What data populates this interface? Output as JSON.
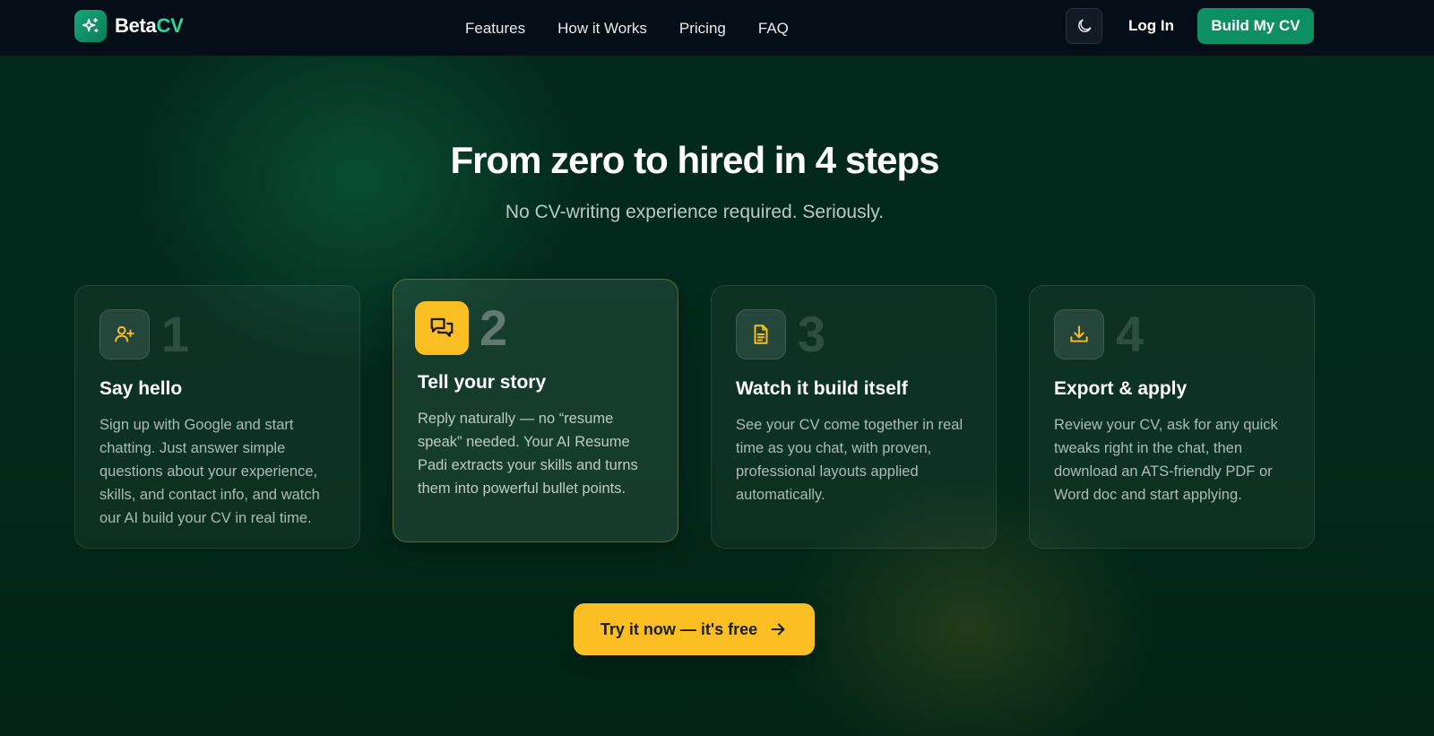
{
  "brand": {
    "name_part1": "Beta",
    "name_part2": "CV",
    "accent": "#34d399",
    "logo_icon": "sparkles-icon"
  },
  "nav": {
    "links": [
      "Features",
      "How it Works",
      "Pricing",
      "FAQ"
    ],
    "theme_toggle_icon": "moon-icon",
    "login_label": "Log In",
    "cta_label": "Build My CV",
    "cta_color": "#0e8f63"
  },
  "section": {
    "title": "From zero to hired in 4 steps",
    "subtitle": "No CV-writing experience required. Seriously."
  },
  "steps": [
    {
      "number": "1",
      "icon": "user-plus-icon",
      "title": "Say hello",
      "description": "Sign up with Google and start chatting. Just answer simple questions about your experience, skills, and contact info, and watch our AI build your CV in real time.",
      "active": false
    },
    {
      "number": "2",
      "icon": "chat-bubbles-icon",
      "title": "Tell your story",
      "description": "Reply naturally — no “resume speak” needed. Your AI Resume Padi extracts your skills and turns them into powerful bullet points.",
      "active": true
    },
    {
      "number": "3",
      "icon": "document-icon",
      "title": "Watch it build itself",
      "description": "See your CV come together in real time as you chat, with proven, professional layouts applied automatically.",
      "active": false
    },
    {
      "number": "4",
      "icon": "download-icon",
      "title": "Export & apply",
      "description": "Review your CV, ask for any quick tweaks right in the chat, then download an ATS-friendly PDF or Word doc and start applying.",
      "active": false
    }
  ],
  "cta": {
    "label": "Try it now — it's free",
    "icon": "arrow-right-icon",
    "color": "#fbbf24"
  }
}
